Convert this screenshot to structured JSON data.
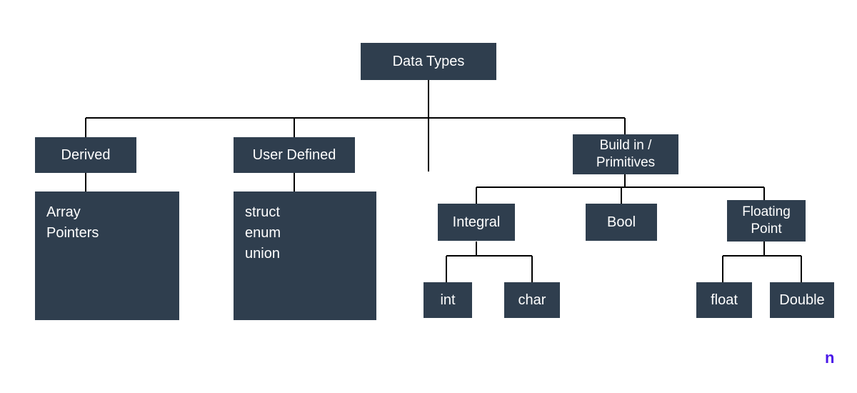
{
  "root": {
    "label": "Data Types"
  },
  "derived": {
    "label": "Derived",
    "items": [
      "Array",
      "Pointers"
    ]
  },
  "user_defined": {
    "label": "User Defined",
    "items": [
      "struct",
      "enum",
      "union"
    ]
  },
  "builtin": {
    "label": "Build in / Primitives",
    "integral": {
      "label": "Integral",
      "int": "int",
      "char": "char"
    },
    "bool": "Bool",
    "floating": {
      "label": "Floating Point",
      "float": "float",
      "double": "Double"
    }
  },
  "watermark": "n"
}
